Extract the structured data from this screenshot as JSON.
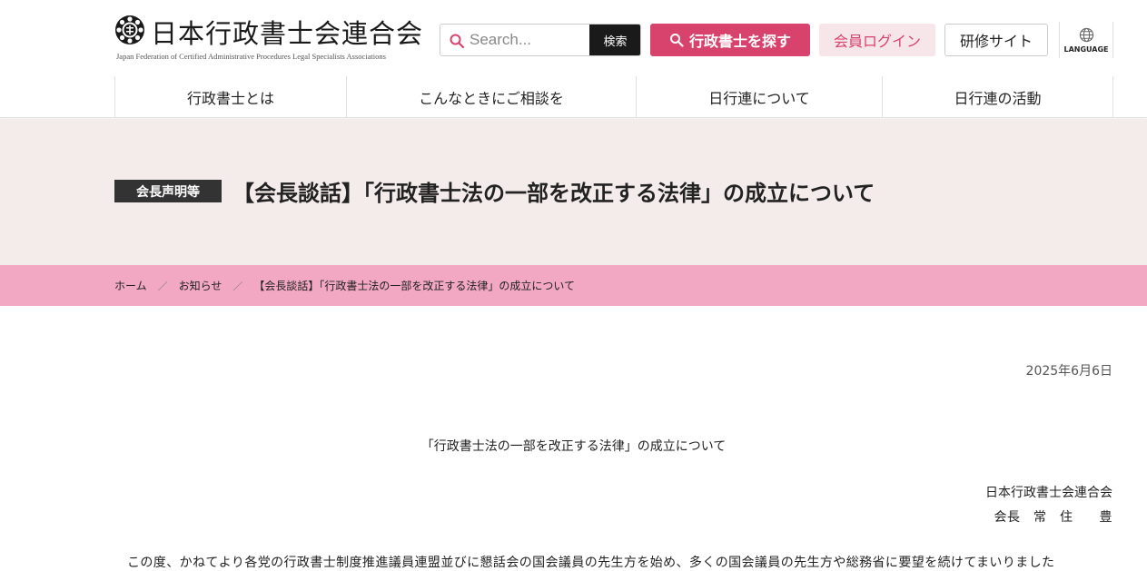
{
  "header": {
    "logo_title": "日本行政書士会連合会",
    "logo_subtitle": "Japan Federation of Certified Administrative Procedures Legal Specialists Associations",
    "search_placeholder": "Search...",
    "search_button": "検索",
    "find_button": "行政書士を探す",
    "login_button": "会員ログイン",
    "training_button": "研修サイト",
    "language_label": "LANGUAGE",
    "accent_color": "#d8436e"
  },
  "nav": {
    "items": [
      {
        "label": "行政書士とは"
      },
      {
        "label": "こんなときにご相談を"
      },
      {
        "label": "日行連について"
      },
      {
        "label": "日行連の活動"
      }
    ]
  },
  "hero": {
    "badge": "会長声明等",
    "title": "【会長談話】「行政書士法の一部を改正する法律」の成立について"
  },
  "breadcrumb": {
    "home": "ホーム",
    "news": "お知らせ",
    "current": "【会長談話】「行政書士法の一部を改正する法律」の成立について",
    "separator": "／"
  },
  "article": {
    "date": "2025年6月6日",
    "title": "「行政書士法の一部を改正する法律」の成立について",
    "org": "日本行政書士会連合会",
    "signature": "会長　常　住　　豊",
    "first_line": "この度、かねてより各党の行政書士制度推進議員連盟並びに懇話会の国会議員の先生方を始め、多くの国会議員の先生方や総務省に要望を続けてまいりました"
  }
}
